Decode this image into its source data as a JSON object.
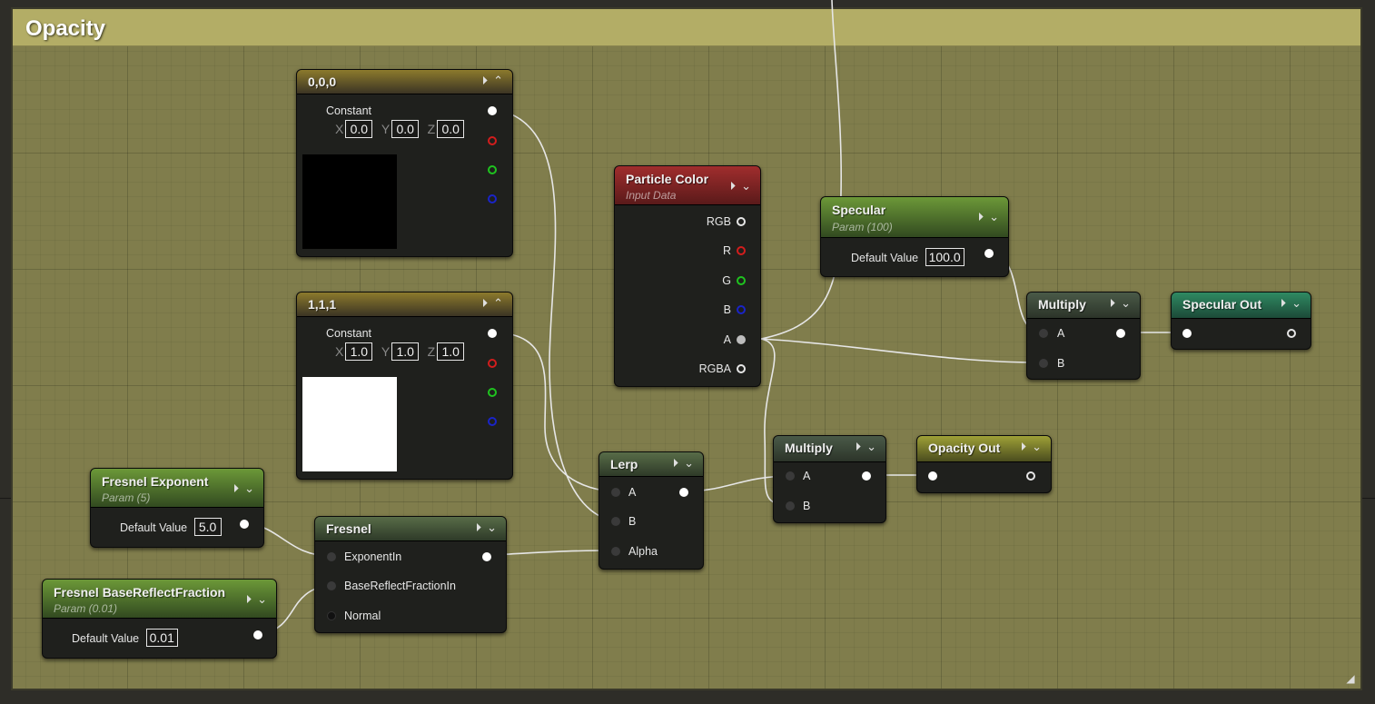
{
  "comment": {
    "title": "Opacity"
  },
  "icons": {
    "play": "play-circle-icon",
    "collapse": "chevron-up-icon",
    "expand": "chevron-down-icon",
    "resize": "resize-grip-icon"
  },
  "colors": {
    "comment_bg": "#807d4c",
    "comment_header": "#b3ad66",
    "node_bg": "#1f201d",
    "wire": "#e6e6e6"
  },
  "nodes": {
    "const0": {
      "title": "0,0,0",
      "label": "Constant",
      "x_label": "X",
      "y_label": "Y",
      "z_label": "Z",
      "x": "0.0",
      "y": "0.0",
      "z": "0.0",
      "swatch": "#000000"
    },
    "const1": {
      "title": "1,1,1",
      "label": "Constant",
      "x_label": "X",
      "y_label": "Y",
      "z_label": "Z",
      "x": "1.0",
      "y": "1.0",
      "z": "1.0",
      "swatch": "#ffffff"
    },
    "particle_color": {
      "title": "Particle Color",
      "subtitle": "Input Data",
      "pins": [
        "RGB",
        "R",
        "G",
        "B",
        "A",
        "RGBA"
      ]
    },
    "specular": {
      "title": "Specular",
      "subtitle": "Param (100)",
      "default_label": "Default Value",
      "value": "100.0"
    },
    "multiply_top": {
      "title": "Multiply",
      "pin_a": "A",
      "pin_b": "B"
    },
    "specular_out": {
      "title": "Specular Out"
    },
    "lerp": {
      "title": "Lerp",
      "pin_a": "A",
      "pin_b": "B",
      "pin_alpha": "Alpha"
    },
    "multiply_bottom": {
      "title": "Multiply",
      "pin_a": "A",
      "pin_b": "B"
    },
    "opacity_out": {
      "title": "Opacity Out"
    },
    "fresnel_exponent": {
      "title": "Fresnel Exponent",
      "subtitle": "Param (5)",
      "default_label": "Default Value",
      "value": "5.0"
    },
    "fresnel": {
      "title": "Fresnel",
      "pin_exp": "ExponentIn",
      "pin_base": "BaseReflectFractionIn",
      "pin_normal": "Normal"
    },
    "fresnel_base": {
      "title": "Fresnel BaseReflectFraction",
      "subtitle": "Param (0.01)",
      "default_label": "Default Value",
      "value": "0.01"
    }
  }
}
